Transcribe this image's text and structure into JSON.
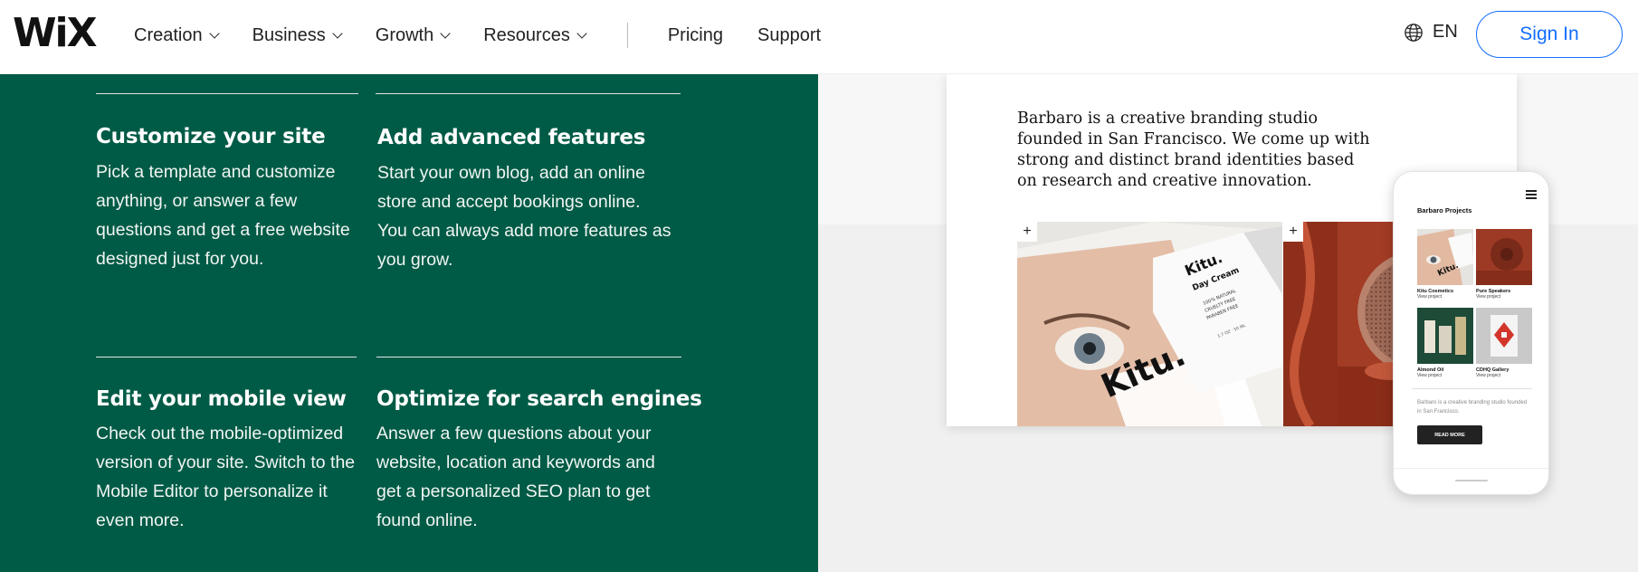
{
  "header": {
    "logo": "WiX",
    "nav": [
      {
        "label": "Creation",
        "has_dropdown": true
      },
      {
        "label": "Business",
        "has_dropdown": true
      },
      {
        "label": "Growth",
        "has_dropdown": true
      },
      {
        "label": "Resources",
        "has_dropdown": true
      },
      {
        "label": "Pricing",
        "has_dropdown": false
      },
      {
        "label": "Support",
        "has_dropdown": false
      }
    ],
    "language": "EN",
    "language_icon": "globe-icon",
    "signin_label": "Sign In",
    "accent_color": "#116dff"
  },
  "features": [
    {
      "title": "Customize your site",
      "text": "Pick a template and customize anything, or answer a few questions and get a free website designed just for you."
    },
    {
      "title": "Add advanced features",
      "text": "Start your own blog, add an online store and accept bookings online. You can always add more features as you grow."
    },
    {
      "title": "Edit your mobile view",
      "text": "Check out the mobile-optimized version of your site. Switch to the Mobile Editor to personalize it even more."
    },
    {
      "title": "Optimize for search engines",
      "text": "Answer a few questions about your website, location and keywords and get a personalized SEO plan to get found online."
    }
  ],
  "panel_color": "#005b46",
  "preview": {
    "description": "Barbaro is a creative branding studio founded in San Francisco. We come up with strong and distinct brand identities based on research and creative innovation.",
    "thumb1_logo": "Kitu.",
    "box_brand": "Kitu.",
    "box_product": "Day Cream",
    "box_claims": [
      "100% NATURAL",
      "CRUELTY FREE",
      "PARABEN FREE"
    ],
    "box_size": "1.7 OZ · 50 ML",
    "plus_icon": "+"
  },
  "phone": {
    "title": "Barbaro Projects",
    "projects": [
      {
        "name": "Kitu Cosmetics",
        "link": "View project"
      },
      {
        "name": "Pure Speakers",
        "link": "View project"
      },
      {
        "name": "Almond Oil",
        "link": "View project"
      },
      {
        "name": "CDHQ Gallery",
        "link": "View project"
      }
    ],
    "description": "Barbaro is a creative branding studio founded in San Francisco.",
    "button": "READ MORE"
  }
}
